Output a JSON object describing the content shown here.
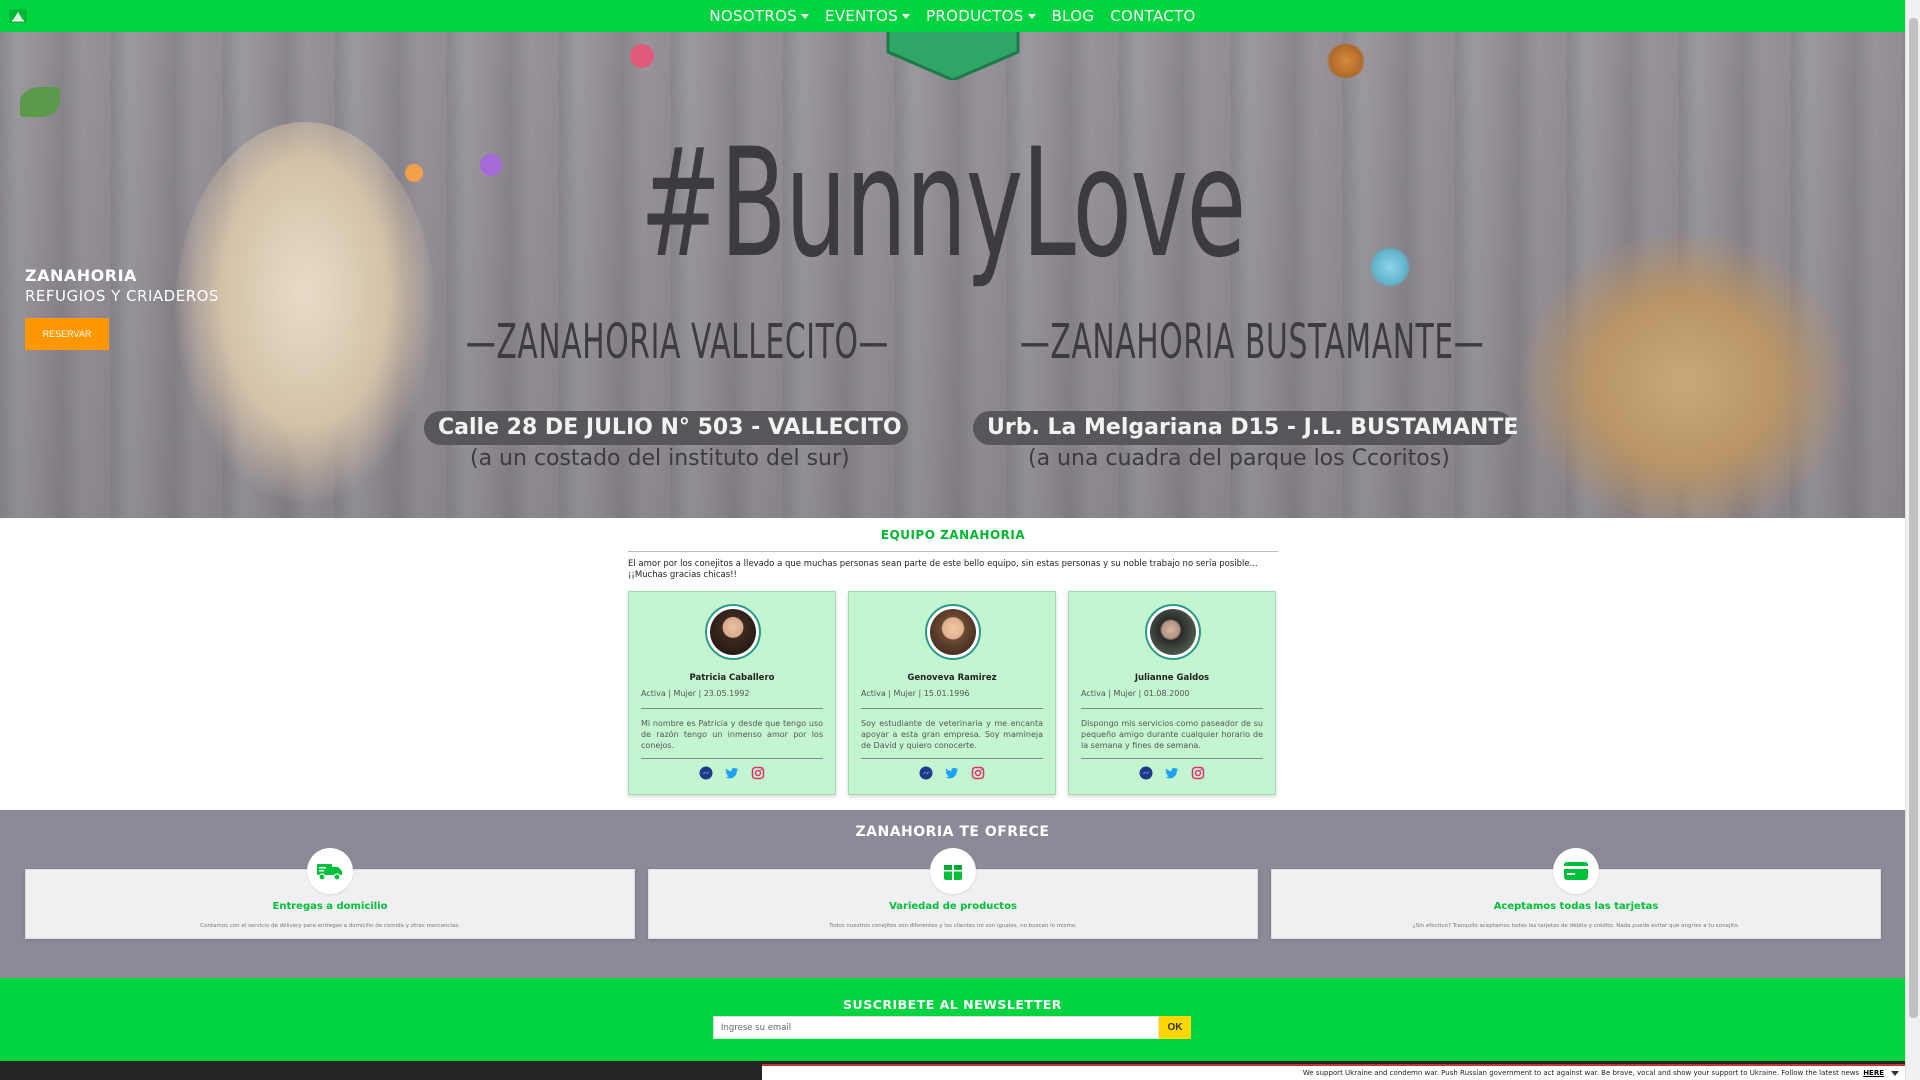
{
  "navbar": {
    "logo_icon": "zanahoria-logo-icon",
    "items": [
      {
        "label": "NOSOTROS",
        "dropdown": true
      },
      {
        "label": "EVENTOS",
        "dropdown": true
      },
      {
        "label": "PRODUCTOS",
        "dropdown": true
      },
      {
        "label": "BLOG",
        "dropdown": false
      },
      {
        "label": "CONTACTO",
        "dropdown": false
      }
    ],
    "color": "#00d43f"
  },
  "hero": {
    "hashtag": "#BunnyLove",
    "locations": [
      {
        "title": "—ZANAHORIA VALLECITO—",
        "address": "Calle 28 DE JULIO N° 503 - VALLECITO",
        "reference": "(a un costado del instituto del sur)"
      },
      {
        "title": "—ZANAHORIA BUSTAMANTE—",
        "address": "Urb. La Melgariana D15 - J.L. BUSTAMANTE",
        "reference": "(a una cuadra del parque los Ccoritos)"
      }
    ],
    "caption_title": "ZANAHORIA",
    "caption_subtitle": "REFUGIOS Y CRIADEROS",
    "reserve_label": "RESERVAR",
    "reserve_color": "#ff9800"
  },
  "team": {
    "title": "EQUIPO ZANAHORIA",
    "intro": "El amor por los conejitos a llevado a que muchas personas sean parte de este bello equipo, sin estas personas y su noble trabajo no sería posible... ¡¡Muchas gracias chicas!!",
    "members": [
      {
        "name": "Patricia Caballero",
        "meta": "Activa | Mujer | 23.05.1992",
        "bio": "Mi nombre es Patricia y desde que tengo uso de razón tengo un inmenso amor por los conejos."
      },
      {
        "name": "Genoveva Ramirez",
        "meta": "Activa | Mujer | 15.01.1996",
        "bio": "Soy estudiante de veterinaria y me encanta apoyar a esta gran empresa. Soy mamineja de David y quiero conocerte."
      },
      {
        "name": "Julianne Galdos",
        "meta": "Activa | Mujer | 01.08.2000",
        "bio": "Dispongo mis servicios como paseador de su pequeño amigo durante cualquier horario de la semana y fines de semana."
      }
    ],
    "social_icons": [
      "messenger-icon",
      "twitter-icon",
      "instagram-icon"
    ]
  },
  "offers": {
    "title": "ZANAHORIA TE OFRECE",
    "items": [
      {
        "icon": "delivery-truck-icon",
        "title": "Entregas a domicilio",
        "desc": "Contamos con el servicio de delivery para entregas a domicilio de comida y otras mercancías."
      },
      {
        "icon": "box-icon",
        "title": "Variedad de productos",
        "desc": "Todos nuestros conejitos son diferentes y los clientes no son iguales, no buscan lo mismo."
      },
      {
        "icon": "credit-card-icon",
        "title": "Aceptamos todas las tarjetas",
        "desc": "¿Sin efectivo? Tranquilo aceptamos todas las tarjetas de débito y crédito. Nada puede evitar que engríes a tu conejito."
      }
    ],
    "accent": "#00c03a"
  },
  "newsletter": {
    "title": "SUSCRIBETE AL NEWSLETTER",
    "placeholder": "Ingrese su email",
    "button_label": "OK",
    "button_color": "#ffd600"
  },
  "banner": {
    "text": "We support Ukraine and condemn war. Push Russian government to act against war. Be brave, vocal and show your support to Ukraine. Follow the latest news",
    "link": "HERE"
  }
}
